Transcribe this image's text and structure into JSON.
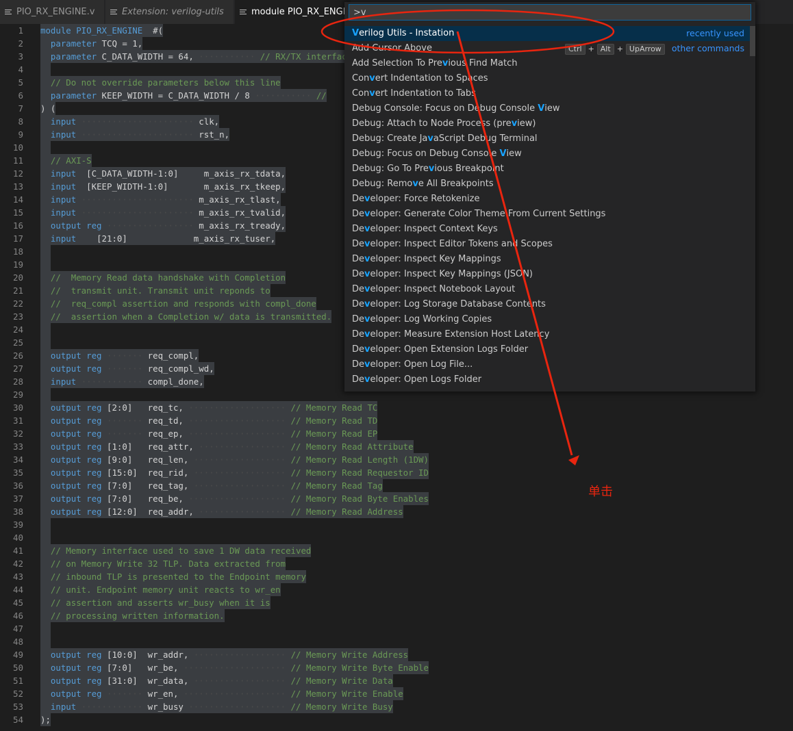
{
  "tabs": [
    {
      "label": "PIO_RX_ENGINE.v",
      "active": false,
      "italic": false
    },
    {
      "label": "Extension: verilog-utils",
      "active": false,
      "italic": true
    },
    {
      "label": "module PIO_RX_ENGINE",
      "active": true,
      "italic": false
    }
  ],
  "palette": {
    "input_value": ">v",
    "items": [
      {
        "label": "Verilog Utils - Instation",
        "highlight": "V",
        "right": "recently used",
        "selected": true
      },
      {
        "label": "Add Cursor Above",
        "highlight": "",
        "keys": [
          "Ctrl",
          "Alt",
          "UpArrow"
        ],
        "right": "other commands"
      },
      {
        "label": "Add Selection To Previous Find Match",
        "highlight": "v"
      },
      {
        "label": "Convert Indentation to Spaces",
        "highlight": "v"
      },
      {
        "label": "Convert Indentation to Tabs",
        "highlight": "v"
      },
      {
        "label": "Debug Console: Focus on Debug Console View",
        "highlight": "V"
      },
      {
        "label": "Debug: Attach to Node Process (preview)",
        "highlight": "v"
      },
      {
        "label": "Debug: Create JavaScript Debug Terminal",
        "highlight": "v"
      },
      {
        "label": "Debug: Focus on Debug Console View",
        "highlight": "V"
      },
      {
        "label": "Debug: Go To Previous Breakpoint",
        "highlight": "v"
      },
      {
        "label": "Debug: Remove All Breakpoints",
        "highlight": "v"
      },
      {
        "label": "Developer: Force Retokenize",
        "highlight": "v"
      },
      {
        "label": "Developer: Generate Color Theme From Current Settings",
        "highlight": "v"
      },
      {
        "label": "Developer: Inspect Context Keys",
        "highlight": "v"
      },
      {
        "label": "Developer: Inspect Editor Tokens and Scopes",
        "highlight": "v"
      },
      {
        "label": "Developer: Inspect Key Mappings",
        "highlight": "v"
      },
      {
        "label": "Developer: Inspect Key Mappings (JSON)",
        "highlight": "v"
      },
      {
        "label": "Developer: Inspect Notebook Layout",
        "highlight": "v"
      },
      {
        "label": "Developer: Log Storage Database Contents",
        "highlight": "v"
      },
      {
        "label": "Developer: Log Working Copies",
        "highlight": "v"
      },
      {
        "label": "Developer: Measure Extension Host Latency",
        "highlight": "v"
      },
      {
        "label": "Developer: Open Extension Logs Folder",
        "highlight": "v"
      },
      {
        "label": "Developer: Open Log File...",
        "highlight": "v"
      },
      {
        "label": "Developer: Open Logs Folder",
        "highlight": "v"
      }
    ]
  },
  "annotation": {
    "text": "单击",
    "color": "#e8250f"
  },
  "code_lines": [
    [
      [
        "kw",
        "module PIO_RX_ENGINE"
      ],
      [
        "",
        "  #("
      ]
    ],
    [
      [
        "",
        "  "
      ],
      [
        "kw",
        "parameter"
      ],
      [
        "",
        " TCQ = 1,"
      ]
    ],
    [
      [
        "",
        "  "
      ],
      [
        "kw",
        "parameter"
      ],
      [
        "",
        " C_DATA_WIDTH = 64,"
      ],
      [
        "dots",
        " ··········· "
      ],
      [
        "cm",
        "// RX/TX interface"
      ]
    ],
    [
      [
        "",
        ""
      ]
    ],
    [
      [
        "",
        "  "
      ],
      [
        "cm",
        "// Do not override parameters below this line"
      ]
    ],
    [
      [
        "",
        "  "
      ],
      [
        "kw",
        "parameter"
      ],
      [
        "",
        " KEEP_WIDTH = C_DATA_WIDTH / 8"
      ],
      [
        "dots",
        " ··········· "
      ],
      [
        "cm",
        "//"
      ]
    ],
    [
      [
        "",
        ") ("
      ]
    ],
    [
      [
        "",
        "  "
      ],
      [
        "kw",
        "input"
      ],
      [
        "dots",
        " ······················ "
      ],
      [
        "",
        "clk,"
      ]
    ],
    [
      [
        "",
        "  "
      ],
      [
        "kw",
        "input"
      ],
      [
        "dots",
        " ······················ "
      ],
      [
        "",
        "rst_n,"
      ]
    ],
    [
      [
        "",
        ""
      ]
    ],
    [
      [
        "",
        "  "
      ],
      [
        "cm",
        "// AXI-S"
      ]
    ],
    [
      [
        "",
        "  "
      ],
      [
        "kw",
        "input"
      ],
      [
        "",
        "  [C_DATA_WIDTH-1:0]     m_axis_rx_tdata,"
      ]
    ],
    [
      [
        "",
        "  "
      ],
      [
        "kw",
        "input"
      ],
      [
        "",
        "  [KEEP_WIDTH-1:0]       m_axis_rx_tkeep,"
      ]
    ],
    [
      [
        "",
        "  "
      ],
      [
        "kw",
        "input"
      ],
      [
        "dots",
        " ······················ "
      ],
      [
        "",
        "m_axis_rx_tlast,"
      ]
    ],
    [
      [
        "",
        "  "
      ],
      [
        "kw",
        "input"
      ],
      [
        "dots",
        " ······················ "
      ],
      [
        "",
        "m_axis_rx_tvalid,"
      ]
    ],
    [
      [
        "",
        "  "
      ],
      [
        "kw",
        "output reg"
      ],
      [
        "dots",
        " ················· "
      ],
      [
        "",
        "m_axis_rx_tready,"
      ]
    ],
    [
      [
        "",
        "  "
      ],
      [
        "kw",
        "input"
      ],
      [
        "",
        "    [21:0]             m_axis_rx_tuser,"
      ]
    ],
    [
      [
        "",
        ""
      ]
    ],
    [
      [
        "",
        ""
      ]
    ],
    [
      [
        "",
        "  "
      ],
      [
        "cm",
        "//  Memory Read data handshake with Completion"
      ]
    ],
    [
      [
        "",
        "  "
      ],
      [
        "cm",
        "//  transmit unit. Transmit unit reponds to"
      ]
    ],
    [
      [
        "",
        "  "
      ],
      [
        "cm",
        "//  req_compl assertion and responds with compl_done"
      ]
    ],
    [
      [
        "",
        "  "
      ],
      [
        "cm",
        "//  assertion when a Completion w/ data is transmitted."
      ]
    ],
    [
      [
        "",
        ""
      ]
    ],
    [
      [
        "",
        ""
      ]
    ],
    [
      [
        "",
        "  "
      ],
      [
        "kw",
        "output reg"
      ],
      [
        "dots",
        " ······· "
      ],
      [
        "",
        "req_compl,"
      ]
    ],
    [
      [
        "",
        "  "
      ],
      [
        "kw",
        "output reg"
      ],
      [
        "dots",
        " ······· "
      ],
      [
        "",
        "req_compl_wd,"
      ]
    ],
    [
      [
        "",
        "  "
      ],
      [
        "kw",
        "input"
      ],
      [
        "dots",
        " ············ "
      ],
      [
        "",
        "compl_done,"
      ]
    ],
    [
      [
        "",
        ""
      ]
    ],
    [
      [
        "",
        "  "
      ],
      [
        "kw",
        "output reg"
      ],
      [
        "",
        " [2:0]   req_tc,"
      ],
      [
        "dots",
        " ··················· "
      ],
      [
        "cm",
        "// Memory Read TC"
      ]
    ],
    [
      [
        "",
        "  "
      ],
      [
        "kw",
        "output reg"
      ],
      [
        "dots",
        " ······· "
      ],
      [
        "",
        "req_td,"
      ],
      [
        "dots",
        " ··················· "
      ],
      [
        "cm",
        "// Memory Read TD"
      ]
    ],
    [
      [
        "",
        "  "
      ],
      [
        "kw",
        "output reg"
      ],
      [
        "dots",
        " ······· "
      ],
      [
        "",
        "req_ep,"
      ],
      [
        "dots",
        " ··················· "
      ],
      [
        "cm",
        "// Memory Read EP"
      ]
    ],
    [
      [
        "",
        "  "
      ],
      [
        "kw",
        "output reg"
      ],
      [
        "",
        " [1:0]   req_attr,"
      ],
      [
        "dots",
        " ················· "
      ],
      [
        "cm",
        "// Memory Read Attribute"
      ]
    ],
    [
      [
        "",
        "  "
      ],
      [
        "kw",
        "output reg"
      ],
      [
        "",
        " [9:0]   req_len,"
      ],
      [
        "dots",
        " ·················· "
      ],
      [
        "cm",
        "// Memory Read Length (1DW)"
      ]
    ],
    [
      [
        "",
        "  "
      ],
      [
        "kw",
        "output reg"
      ],
      [
        "",
        " [15:0]  req_rid,"
      ],
      [
        "dots",
        " ·················· "
      ],
      [
        "cm",
        "// Memory Read Requestor ID"
      ]
    ],
    [
      [
        "",
        "  "
      ],
      [
        "kw",
        "output reg"
      ],
      [
        "",
        " [7:0]   req_tag,"
      ],
      [
        "dots",
        " ·················· "
      ],
      [
        "cm",
        "// Memory Read Tag"
      ]
    ],
    [
      [
        "",
        "  "
      ],
      [
        "kw",
        "output reg"
      ],
      [
        "",
        " [7:0]   req_be,"
      ],
      [
        "dots",
        " ··················· "
      ],
      [
        "cm",
        "// Memory Read Byte Enables"
      ]
    ],
    [
      [
        "",
        "  "
      ],
      [
        "kw",
        "output reg"
      ],
      [
        "",
        " [12:0]  req_addr,"
      ],
      [
        "dots",
        " ················· "
      ],
      [
        "cm",
        "// Memory Read Address"
      ]
    ],
    [
      [
        "",
        ""
      ]
    ],
    [
      [
        "",
        ""
      ]
    ],
    [
      [
        "",
        "  "
      ],
      [
        "cm",
        "// Memory interface used to save 1 DW data received"
      ]
    ],
    [
      [
        "",
        "  "
      ],
      [
        "cm",
        "// on Memory Write 32 TLP. Data extracted from"
      ]
    ],
    [
      [
        "",
        "  "
      ],
      [
        "cm",
        "// inbound TLP is presented to the Endpoint memory"
      ]
    ],
    [
      [
        "",
        "  "
      ],
      [
        "cm",
        "// unit. Endpoint memory unit reacts to wr_en"
      ]
    ],
    [
      [
        "",
        "  "
      ],
      [
        "cm",
        "// assertion and asserts wr_busy when it is"
      ]
    ],
    [
      [
        "",
        "  "
      ],
      [
        "cm",
        "// processing written information."
      ]
    ],
    [
      [
        "",
        ""
      ]
    ],
    [
      [
        "",
        ""
      ]
    ],
    [
      [
        "",
        "  "
      ],
      [
        "kw",
        "output reg"
      ],
      [
        "",
        " [10:0]  wr_addr,"
      ],
      [
        "dots",
        " ·················· "
      ],
      [
        "cm",
        "// Memory Write Address"
      ]
    ],
    [
      [
        "",
        "  "
      ],
      [
        "kw",
        "output reg"
      ],
      [
        "",
        " [7:0]   wr_be,"
      ],
      [
        "dots",
        " ···················· "
      ],
      [
        "cm",
        "// Memory Write Byte Enable"
      ]
    ],
    [
      [
        "",
        "  "
      ],
      [
        "kw",
        "output reg"
      ],
      [
        "",
        " [31:0]  wr_data,"
      ],
      [
        "dots",
        " ·················· "
      ],
      [
        "cm",
        "// Memory Write Data"
      ]
    ],
    [
      [
        "",
        "  "
      ],
      [
        "kw",
        "output reg"
      ],
      [
        "dots",
        " ······· "
      ],
      [
        "",
        "wr_en,"
      ],
      [
        "dots",
        " ···················· "
      ],
      [
        "cm",
        "// Memory Write Enable"
      ]
    ],
    [
      [
        "",
        "  "
      ],
      [
        "kw",
        "input"
      ],
      [
        "dots",
        " ············ "
      ],
      [
        "",
        "wr_busy"
      ],
      [
        "dots",
        " ··················· "
      ],
      [
        "cm",
        "// Memory Write Busy"
      ]
    ],
    [
      [
        "",
        ");"
      ]
    ]
  ]
}
